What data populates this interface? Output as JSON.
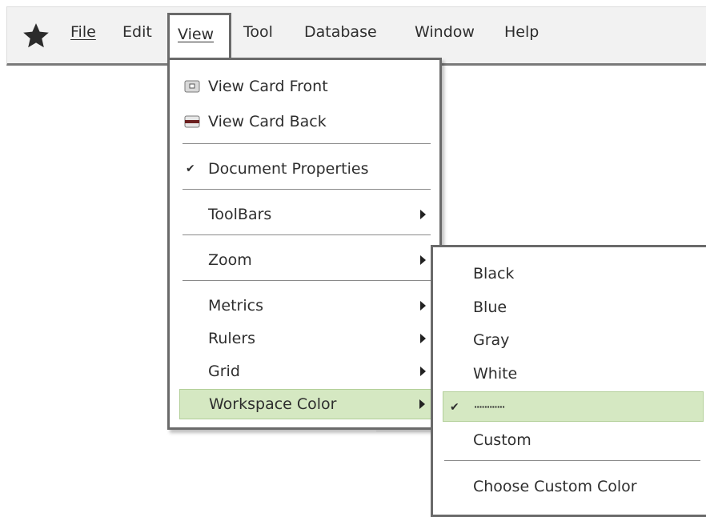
{
  "menubar": {
    "app_icon": "star-icon",
    "menus": [
      {
        "id": "file",
        "label": "File"
      },
      {
        "id": "edit",
        "label": "Edit"
      },
      {
        "id": "view",
        "label": "View"
      },
      {
        "id": "tool",
        "label": "Tool"
      },
      {
        "id": "database",
        "label": "Database"
      },
      {
        "id": "window",
        "label": "Window"
      },
      {
        "id": "help",
        "label": "Help"
      }
    ],
    "open_menu": "View"
  },
  "view_menu": {
    "items": [
      {
        "label": "View Card Front",
        "icon": "card-front-icon"
      },
      {
        "label": "View Card Back",
        "icon": "card-back-icon"
      },
      {
        "label": "Document Properties",
        "checked": true
      },
      {
        "label": "ToolBars",
        "has_submenu": true
      },
      {
        "label": "Zoom",
        "has_submenu": true
      },
      {
        "label": "Metrics",
        "has_submenu": true
      },
      {
        "label": "Rulers",
        "has_submenu": true
      },
      {
        "label": "Grid",
        "has_submenu": true
      },
      {
        "label": "Workspace Color",
        "has_submenu": true,
        "highlighted": true
      }
    ]
  },
  "workspace_color_menu": {
    "items": [
      {
        "label": "Black"
      },
      {
        "label": "Blue"
      },
      {
        "label": "Gray"
      },
      {
        "label": "White"
      },
      {
        "label": "············",
        "checked": true,
        "highlighted": true
      },
      {
        "label": "Custom"
      },
      {
        "label": "Choose Custom Color"
      }
    ]
  },
  "colors": {
    "highlight": "#d5e8c2",
    "menu_border": "#6a6a6a",
    "menubar_bg": "#f2f2f2"
  }
}
